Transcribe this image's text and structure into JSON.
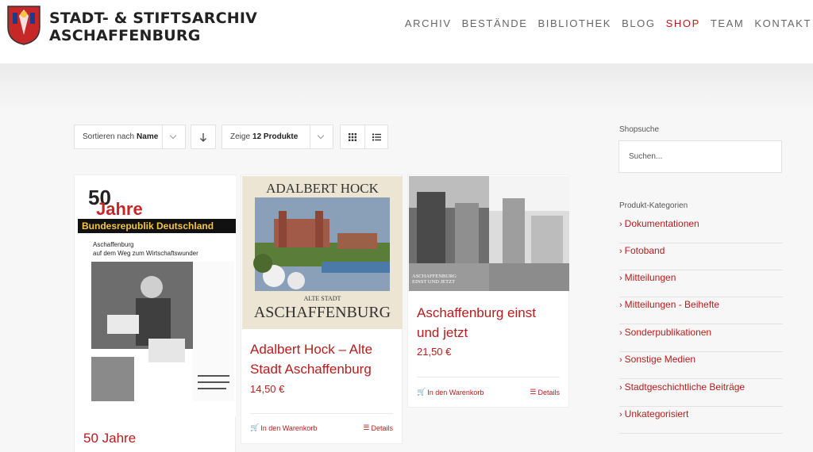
{
  "header": {
    "logo_line1": "STADT- & STIFTSARCHIV",
    "logo_line2": "ASCHAFFENBURG",
    "nav": [
      "ARCHIV",
      "BESTÄNDE",
      "BIBLIOTHEK",
      "BLOG",
      "SHOP",
      "TEAM",
      "KONTAKT"
    ],
    "active_nav": "SHOP"
  },
  "toolbar": {
    "sort_prefix": "Sortieren nach",
    "sort_value": "Name",
    "show_prefix": "Zeige",
    "show_value": "12 Produkte"
  },
  "products": [
    {
      "title": "50 Jahre",
      "cover": {
        "big": "50",
        "jahre": "Jahre",
        "banner": "Bundesrepublik Deutschland",
        "sub1": "Aschaffenburg",
        "sub2": "auf dem Weg zum Wirtschaftswunder"
      }
    },
    {
      "title_line1": "Adalbert Hock – Alte",
      "title_line2": "Stadt Aschaffenburg",
      "price": "14,50 €",
      "cart": "In den Warenkorb",
      "details": "Details",
      "cover": {
        "top": "ADALBERT HOCK",
        "small": "ALTE STADT",
        "big": "ASCHAFFENBURG"
      }
    },
    {
      "title_line1": "Aschaffenburg einst",
      "title_line2": "und jetzt",
      "price": "21,50 €",
      "cart": "In den Warenkorb",
      "details": "Details",
      "cover": {
        "line1": "ASCHAFFENBURG",
        "line2": "EINST UND JETZT"
      }
    }
  ],
  "sidebar": {
    "search_heading": "Shopsuche",
    "search_placeholder": "Suchen...",
    "categories_heading": "Produkt-Kategorien",
    "categories": [
      "Dokumentationen",
      "Fotoband",
      "Mitteilungen",
      "Mitteilungen - Beihefte",
      "Sonderpublikationen",
      "Sonstige Medien",
      "Stadtgeschichtliche Beiträge",
      "Unkategorisiert"
    ]
  },
  "colors": {
    "accent": "#b71c1c",
    "nav": "#666666",
    "background": "#f7f7f7"
  }
}
